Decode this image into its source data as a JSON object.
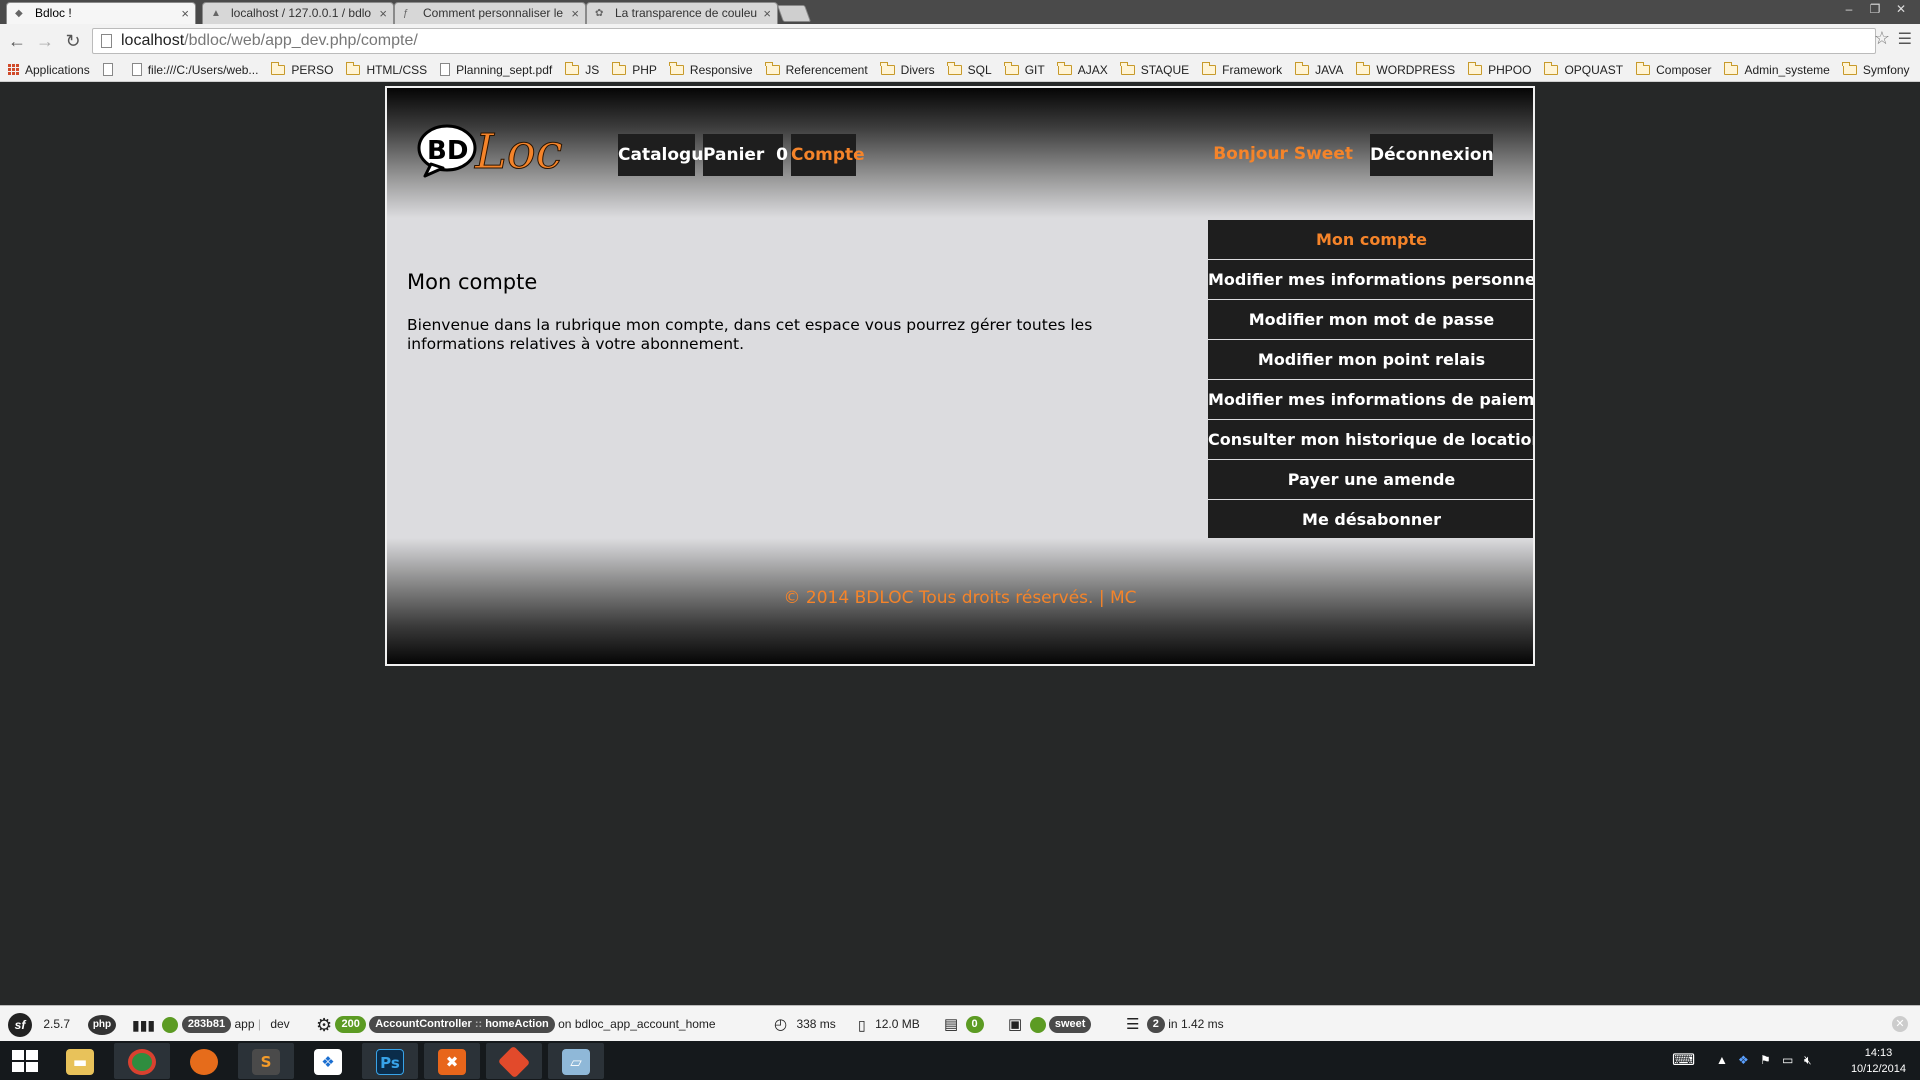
{
  "browser": {
    "tabs": [
      {
        "title": "Bdloc !",
        "active": true
      },
      {
        "title": "localhost / 127.0.0.1 / bdlo",
        "active": false
      },
      {
        "title": "Comment personnaliser le",
        "active": false
      },
      {
        "title": "La transparence de couleu",
        "active": false
      }
    ],
    "url_host": "localhost",
    "url_path": "/bdloc/web/app_dev.php/compte/",
    "bookmarks": [
      {
        "label": "Applications",
        "type": "apps"
      },
      {
        "label": "",
        "type": "file"
      },
      {
        "label": "file:///C:/Users/web...",
        "type": "file"
      },
      {
        "label": "PERSO",
        "type": "folder"
      },
      {
        "label": "HTML/CSS",
        "type": "folder"
      },
      {
        "label": "Planning_sept.pdf",
        "type": "file"
      },
      {
        "label": "JS",
        "type": "folder"
      },
      {
        "label": "PHP",
        "type": "folder"
      },
      {
        "label": "Responsive",
        "type": "folder"
      },
      {
        "label": "Referencement",
        "type": "folder"
      },
      {
        "label": "Divers",
        "type": "folder"
      },
      {
        "label": "SQL",
        "type": "folder"
      },
      {
        "label": "GIT",
        "type": "folder"
      },
      {
        "label": "AJAX",
        "type": "folder"
      },
      {
        "label": "STAQUE",
        "type": "folder"
      },
      {
        "label": "Framework",
        "type": "folder"
      },
      {
        "label": "JAVA",
        "type": "folder"
      },
      {
        "label": "WORDPRESS",
        "type": "folder"
      },
      {
        "label": "PHPOO",
        "type": "folder"
      },
      {
        "label": "OPQUAST",
        "type": "folder"
      },
      {
        "label": "Composer",
        "type": "folder"
      },
      {
        "label": "Admin_systeme",
        "type": "folder"
      },
      {
        "label": "Symfony",
        "type": "folder"
      }
    ]
  },
  "site": {
    "logo_text_bd": "BD",
    "logo_text_loc": "Loc",
    "nav": {
      "catalogue": "Catalogue",
      "panier": "Panier",
      "panier_count": "0",
      "compte": "Compte"
    },
    "greeting": "Bonjour Sweet",
    "logout": "Déconnexion",
    "main": {
      "title": "Mon compte",
      "text": "Bienvenue dans la rubrique mon compte, dans cet espace vous pourrez gérer toutes les informations relatives à votre abonnement."
    },
    "side_menu": [
      {
        "label": "Mon compte",
        "active": true
      },
      {
        "label": "Modifier mes informations personnelles",
        "active": false
      },
      {
        "label": "Modifier mon mot de passe",
        "active": false
      },
      {
        "label": "Modifier mon point relais",
        "active": false
      },
      {
        "label": "Modifier mes informations de paiement",
        "active": false
      },
      {
        "label": "Consulter mon historique de locations",
        "active": false
      },
      {
        "label": "Payer une amende",
        "active": false
      },
      {
        "label": "Me désabonner",
        "active": false
      }
    ],
    "footer": "© 2014 BDLOC Tous droits réservés. | MC",
    "colors": {
      "accent": "#f5842a",
      "nav_bg": "#1e1e1e"
    }
  },
  "debug_toolbar": {
    "symfony_version": "2.5.7",
    "token": "283b81",
    "app": "app",
    "env": "dev",
    "status": "200",
    "controller": "AccountController",
    "action": "homeAction",
    "route_prefix": "on",
    "route": "bdloc_app_account_home",
    "time": "338 ms",
    "memory": "12.0 MB",
    "logs": "0",
    "user": "sweet",
    "queries": "2",
    "queries_time": "in 1.42 ms"
  },
  "taskbar": {
    "time": "14:13",
    "date": "10/12/2014"
  }
}
